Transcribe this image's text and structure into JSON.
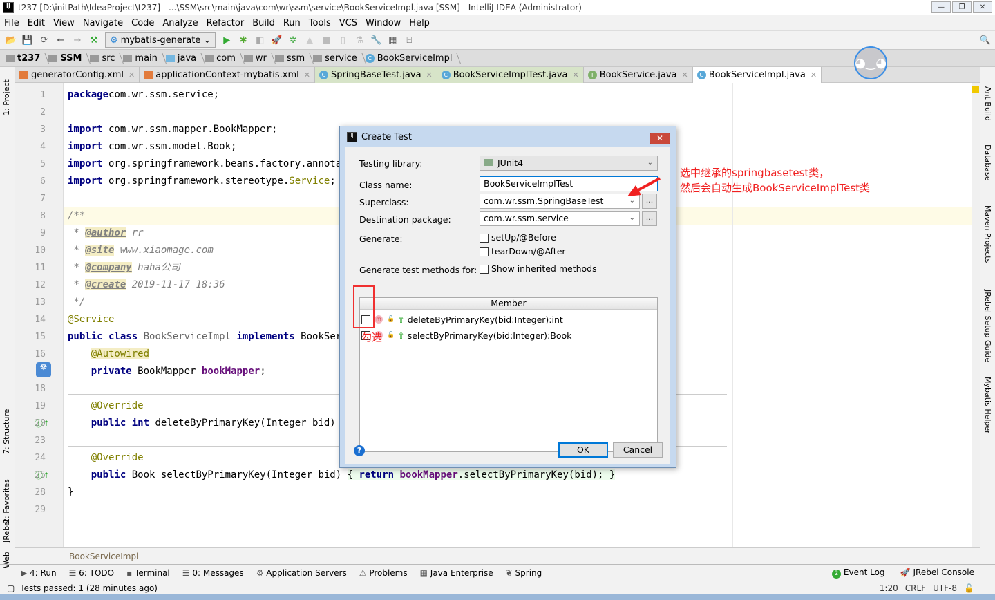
{
  "window": {
    "title": "t237 [D:\\initPath\\IdeaProject\\t237] - ...\\SSM\\src\\main\\java\\com\\wr\\ssm\\service\\BookServiceImpl.java [SSM] - IntelliJ IDEA (Administrator)",
    "logo": "IJ"
  },
  "menu": [
    "File",
    "Edit",
    "View",
    "Navigate",
    "Code",
    "Analyze",
    "Refactor",
    "Build",
    "Run",
    "Tools",
    "VCS",
    "Window",
    "Help"
  ],
  "toolbar": {
    "run_config": "mybatis-generate"
  },
  "breadcrumb": [
    "t237",
    "SSM",
    "src",
    "main",
    "java",
    "com",
    "wr",
    "ssm",
    "service",
    "BookServiceImpl"
  ],
  "tabs": [
    {
      "label": "generatorConfig.xml",
      "kind": "xml"
    },
    {
      "label": "applicationContext-mybatis.xml",
      "kind": "xml"
    },
    {
      "label": "SpringBaseTest.java",
      "kind": "test"
    },
    {
      "label": "BookServiceImplTest.java",
      "kind": "test"
    },
    {
      "label": "BookService.java",
      "kind": "interface"
    },
    {
      "label": "BookServiceImpl.java",
      "kind": "active"
    }
  ],
  "left_tools": [
    "1: Project",
    "7: Structure",
    "2: Favorites",
    "Web",
    "JRebel"
  ],
  "right_tools": [
    "Ant Build",
    "Database",
    "Maven Projects",
    "JRebel Setup Guide",
    "Mybatis Helper"
  ],
  "code": [
    {
      "n": "1",
      "t": [
        [
          "kw",
          "package"
        ],
        [
          "",
          "com.wr.ssm.service;"
        ]
      ]
    },
    {
      "n": "2",
      "t": []
    },
    {
      "n": "3",
      "t": [
        [
          "kw",
          "import"
        ],
        [
          "",
          " com.wr.ssm.mapper.BookMapper;"
        ]
      ]
    },
    {
      "n": "4",
      "t": [
        [
          "kw",
          "import"
        ],
        [
          "",
          " com.wr.ssm.model.Book;"
        ]
      ]
    },
    {
      "n": "5",
      "t": [
        [
          "kw",
          "import"
        ],
        [
          "",
          " org.springframework.beans.factory.annotation.Autowired;"
        ]
      ]
    },
    {
      "n": "6",
      "t": [
        [
          "kw",
          "import"
        ],
        [
          "",
          " org.springframework.stereotype."
        ],
        [
          "ann",
          "Service"
        ],
        [
          "",
          ";"
        ]
      ]
    },
    {
      "n": "7",
      "t": []
    },
    {
      "n": "8",
      "t": [
        [
          "doc",
          "/**"
        ]
      ],
      "cur": true
    },
    {
      "n": "9",
      "t": [
        [
          "doc",
          " * "
        ],
        [
          "doctag",
          "@author"
        ],
        [
          "doc",
          " rr"
        ]
      ]
    },
    {
      "n": "10",
      "t": [
        [
          "doc",
          " * "
        ],
        [
          "doctag",
          "@site"
        ],
        [
          "doc",
          " www.xiaomage.com"
        ]
      ]
    },
    {
      "n": "11",
      "t": [
        [
          "doc",
          " * "
        ],
        [
          "doctag",
          "@company"
        ],
        [
          "doc",
          " haha公司"
        ]
      ]
    },
    {
      "n": "12",
      "t": [
        [
          "doc",
          " * "
        ],
        [
          "doctag",
          "@create"
        ],
        [
          "doc",
          " 2019-11-17 18:36"
        ]
      ]
    },
    {
      "n": "13",
      "t": [
        [
          "doc",
          " */"
        ]
      ]
    },
    {
      "n": "14",
      "t": [
        [
          "ann",
          "@Service"
        ]
      ]
    },
    {
      "n": "15",
      "t": [
        [
          "kw",
          "public class"
        ],
        [
          "gry",
          " BookServiceImpl "
        ],
        [
          "kw",
          "implements"
        ],
        [
          "",
          " BookService {"
        ]
      ]
    },
    {
      "n": "16",
      "t": [
        [
          "",
          "    "
        ],
        [
          "ann hl",
          "@Autowired"
        ]
      ]
    },
    {
      "n": "17",
      "t": [
        [
          "",
          "    "
        ],
        [
          "kw",
          "private"
        ],
        [
          "",
          " BookMapper "
        ],
        [
          "fld",
          "bookMapper"
        ],
        [
          "",
          ";"
        ]
      ]
    },
    {
      "n": "18",
      "t": []
    },
    {
      "n": "19",
      "t": [
        [
          "",
          "    "
        ],
        [
          "ann",
          "@Override"
        ]
      ]
    },
    {
      "n": "20",
      "t": [
        [
          "",
          "    "
        ],
        [
          "kw",
          "public int"
        ],
        [
          "",
          " deleteByPrimaryKey(Integer bid) "
        ],
        [
          "fold-br",
          "{"
        ]
      ]
    },
    {
      "n": "23",
      "t": []
    },
    {
      "n": "24",
      "t": [
        [
          "",
          "    "
        ],
        [
          "ann",
          "@Override"
        ]
      ]
    },
    {
      "n": "25",
      "t": [
        [
          "",
          "    "
        ],
        [
          "kw",
          "public"
        ],
        [
          "",
          " Book selectByPrimaryKey(Integer bid) "
        ],
        [
          "fold-br",
          "{ "
        ],
        [
          "kw fold-br",
          "return "
        ],
        [
          "fld fold-br",
          "bookMapper"
        ],
        [
          "fold-br",
          ".selectByPrimaryKey(bid); }"
        ]
      ]
    },
    {
      "n": "28",
      "t": [
        [
          "",
          "}"
        ]
      ]
    },
    {
      "n": "29",
      "t": []
    }
  ],
  "navbar": "BookServiceImpl",
  "tool_windows": [
    "4: Run",
    "6: TODO",
    "Terminal",
    "0: Messages",
    "Application Servers",
    "Problems",
    "Java Enterprise",
    "Spring"
  ],
  "tool_windows_right": [
    "Event Log",
    "JRebel Console"
  ],
  "event_log_count": "2",
  "status": {
    "message": "Tests passed: 1 (28 minutes ago)",
    "position": "1:20",
    "line_sep": "CRLF",
    "encoding": "UTF-8"
  },
  "dialog": {
    "title": "Create Test",
    "testing_library_label": "Testing library:",
    "testing_library": "JUnit4",
    "class_name_label": "Class name:",
    "class_name": "BookServiceImplTest",
    "superclass_label": "Superclass:",
    "superclass": "com.wr.ssm.SpringBaseTest",
    "dest_label": "Destination package:",
    "dest": "com.wr.ssm.service",
    "generate_label": "Generate:",
    "setup": "setUp/@Before",
    "teardown": "tearDown/@After",
    "methods_label": "Generate test methods for:",
    "show_inherited": "Show inherited methods",
    "member_header": "Member",
    "members": [
      {
        "label": "deleteByPrimaryKey(bid:Integer):int",
        "checked": false
      },
      {
        "label": "selectByPrimaryKey(bid:Integer):Book",
        "checked": false
      }
    ],
    "ok": "OK",
    "cancel": "Cancel",
    "ellipsis": "...",
    "help": "?"
  },
  "annotations": {
    "line1": "选中继承的springbasetest类，",
    "line2": "然后会自动生成BookServiceImplTest类",
    "check_note": "勾选",
    "color": "#f02020"
  }
}
